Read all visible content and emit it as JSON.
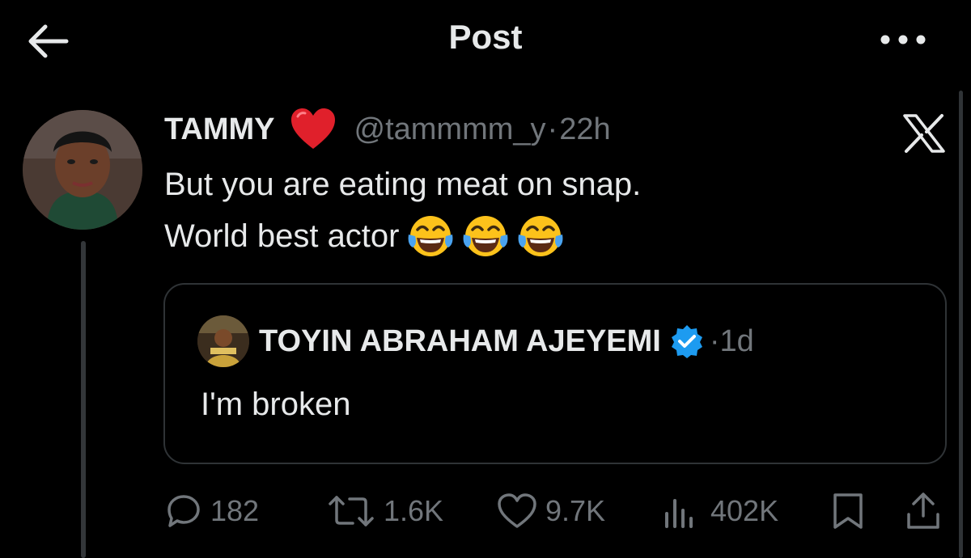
{
  "header": {
    "title": "Post"
  },
  "post": {
    "author_name": "TAMMY",
    "handle": "@tammmm_y",
    "separator": "·",
    "time": "22h",
    "text_line1": "But you are eating meat on snap.",
    "text_line2": "World best actor"
  },
  "quote": {
    "author_name": "TOYIN ABRAHAM AJEYEMI",
    "separator": "·",
    "time": "1d",
    "text": "I'm broken"
  },
  "actions": {
    "replies": "182",
    "reposts": "1.6K",
    "likes": "9.7K",
    "views": "402K"
  },
  "colors": {
    "background": "#000000",
    "text": "#e7e9ea",
    "muted": "#71767b",
    "border": "#2f3336",
    "verified": "#1d9bf0"
  }
}
